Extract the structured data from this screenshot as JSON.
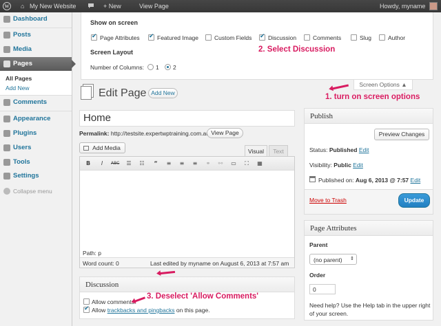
{
  "admin_bar": {
    "site_name": "My New Website",
    "comments_count": "",
    "new_label": "+ New",
    "view_page": "View Page",
    "howdy": "Howdy, myname"
  },
  "sidebar": {
    "dashboard": "Dashboard",
    "posts": "Posts",
    "media": "Media",
    "pages": "Pages",
    "all_pages": "All Pages",
    "add_new": "Add New",
    "comments": "Comments",
    "appearance": "Appearance",
    "plugins": "Plugins",
    "users": "Users",
    "tools": "Tools",
    "settings": "Settings",
    "collapse": "Collapse menu"
  },
  "screen_options": {
    "show_on_screen": "Show on screen",
    "options": [
      {
        "label": "Page Attributes",
        "checked": true
      },
      {
        "label": "Featured Image",
        "checked": true
      },
      {
        "label": "Custom Fields",
        "checked": false
      },
      {
        "label": "Discussion",
        "checked": true
      },
      {
        "label": "Comments",
        "checked": false
      },
      {
        "label": "Slug",
        "checked": false
      },
      {
        "label": "Author",
        "checked": false
      }
    ],
    "screen_layout": "Screen Layout",
    "columns_label": "Number of Columns:",
    "col1": "1",
    "col2": "2",
    "tab_label": "Screen Options ▲"
  },
  "annotations": {
    "a1": "1. turn on screen options",
    "a2": "2. Select Discussion",
    "a3": "3. Deselect 'Allow Comments'"
  },
  "editor": {
    "heading": "Edit Page",
    "add_new": "Add New",
    "title_value": "Home",
    "permalink_label": "Permalink:",
    "permalink_url": "http://testsite.expertwptraining.com.au/",
    "view_page": "View Page",
    "add_media": "Add Media",
    "tab_visual": "Visual",
    "tab_text": "Text",
    "path": "Path: p",
    "word_count": "Word count: 0",
    "last_edited": "Last edited by myname on August 6, 2013 at 7:57 am"
  },
  "discussion": {
    "title": "Discussion",
    "allow_comments": "Allow comments.",
    "allow_prefix": "Allow",
    "trackbacks_link": "trackbacks and pingbacks",
    "allow_suffix": "on this page."
  },
  "publish": {
    "title": "Publish",
    "preview": "Preview Changes",
    "status_label": "Status:",
    "status_value": "Published",
    "visibility_label": "Visibility:",
    "visibility_value": "Public",
    "published_on_label": "Published on:",
    "published_on_value": "Aug 6, 2013 @ 7:57",
    "edit": "Edit",
    "trash": "Move to Trash",
    "update": "Update"
  },
  "page_attributes": {
    "title": "Page Attributes",
    "parent_label": "Parent",
    "parent_value": "(no parent)",
    "order_label": "Order",
    "order_value": "0",
    "help": "Need help? Use the Help tab in the upper right of your screen."
  },
  "colors": {
    "accent": "#21759b",
    "annotation": "#d81b60",
    "update_button": "#2e8ece"
  }
}
